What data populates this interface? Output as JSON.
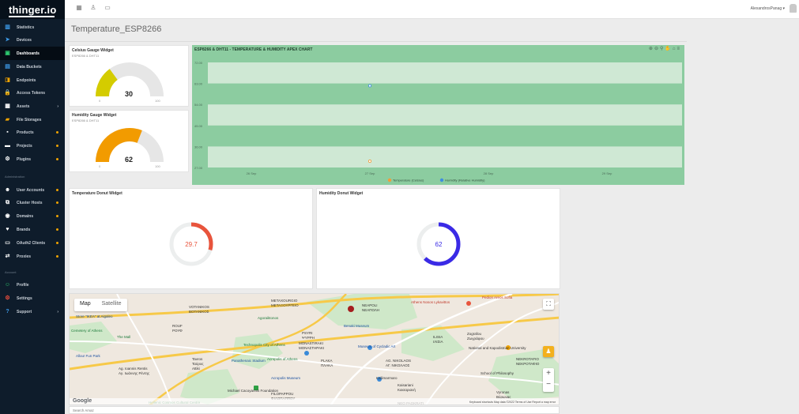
{
  "app": {
    "logo": "thinger.io"
  },
  "topbar": {
    "user_name": "AlexandrosPanag ▾"
  },
  "sidebar": {
    "items": [
      {
        "label": "Statistics",
        "icon": "chart-icon"
      },
      {
        "label": "Devices",
        "icon": "rocket-icon"
      },
      {
        "label": "Dashboards",
        "icon": "dashboard-icon"
      },
      {
        "label": "Data Buckets",
        "icon": "database-icon"
      },
      {
        "label": "Endpoints",
        "icon": "endpoint-icon"
      },
      {
        "label": "Access Tokens",
        "icon": "lock-icon"
      },
      {
        "label": "Assets",
        "icon": "assets-icon"
      },
      {
        "label": "File Storages",
        "icon": "folder-icon"
      },
      {
        "label": "Products",
        "icon": "products-icon"
      },
      {
        "label": "Projects",
        "icon": "projects-icon"
      },
      {
        "label": "Plugins",
        "icon": "plugins-icon"
      },
      {
        "label": "User Accounts",
        "icon": "users-icon"
      },
      {
        "label": "Cluster Hosts",
        "icon": "cluster-icon"
      },
      {
        "label": "Domains",
        "icon": "domains-icon"
      },
      {
        "label": "Brands",
        "icon": "brands-icon"
      },
      {
        "label": "OAuth2 Clients",
        "icon": "oauth-icon"
      },
      {
        "label": "Proxies",
        "icon": "proxies-icon"
      },
      {
        "label": "Profile",
        "icon": "profile-icon"
      },
      {
        "label": "Settings",
        "icon": "settings-icon"
      },
      {
        "label": "Support",
        "icon": "support-icon"
      }
    ],
    "section_admin": "Administration",
    "section_account": "Account"
  },
  "page": {
    "title": "Temperature_ESP8266"
  },
  "widgets": {
    "celsius_gauge": {
      "title": "Celsius Gauge Widget",
      "subtitle": "ESP8266 & DHT11",
      "value": "30",
      "min": "0",
      "max": "100",
      "fraction": 0.3,
      "color": "#d4cc00"
    },
    "humidity_gauge": {
      "title": "Humidity Gauge Widget",
      "subtitle": "ESP8266 & DHT11",
      "value": "62",
      "min": "0",
      "max": "100",
      "fraction": 0.62,
      "color": "#f29b00"
    },
    "temp_donut": {
      "title": "Temperature Donut Widget",
      "value": "29.7",
      "fraction": 0.297,
      "color": "#e8543c"
    },
    "hum_donut": {
      "title": "Humidity Donut Widget",
      "value": "62",
      "fraction": 0.62,
      "color": "#3a2ae6"
    }
  },
  "chart_data": {
    "type": "line",
    "title": "ESP8266 & DHT11 - TEMPERATURE & HUMIDITY APEX CHART",
    "y_ticks": [
      "72.00",
      "63.00",
      "54.00",
      "45.00",
      "36.00",
      "27.00"
    ],
    "x_ticks": [
      "26 Sep",
      "27 Sep",
      "28 Sep",
      "29 Sep"
    ],
    "ylim": [
      27,
      72
    ],
    "series": [
      {
        "name": "Temperature (Celsius)",
        "color": "#f29b3a",
        "points": [
          {
            "x": "27 Sep",
            "y": 29.7
          }
        ]
      },
      {
        "name": "Humidity (Relative Humidity)",
        "color": "#3d8de0",
        "points": [
          {
            "x": "27 Sep",
            "y": 62
          }
        ]
      }
    ],
    "legend": "bottom-center",
    "grid": true
  },
  "map": {
    "type_map": "Map",
    "type_satellite": "Satellite",
    "labels": [
      "METAXOURGIO",
      "ΜΕΤΑΞΟΥΡΓΕΙΟ",
      "NEAPOLI",
      "ΝΕΑΠΟΛΗ",
      "Athens Nosos Lykavittos",
      "Pedion Areos Sofia",
      "VOTANIKOS",
      "ΒΟΤΑΝΙΚΟΣ",
      "Agoraiktonos",
      "Store \"IKEA\" at Aigaleo",
      "ROUF",
      "ΡΟΥΦ",
      "Cemetery of Athens",
      "The Mall",
      "Benaki Museum",
      "PSYRI",
      "ΨΥΡΡΗ",
      "ILISIA",
      "ΙΛΙΣΙΑ",
      "Zografou",
      "Ζωγράφου",
      "Technopolis City of Athens",
      "MONASTIRAKI",
      "ΜΟΝΑΣΤΗΡΑΚΙ",
      "Museum of Cycladic Art",
      "National and Kapodistrian University",
      "Allou! Fun Park",
      "Acropolis of Athens",
      "PLAKA",
      "ΠΛΑΚΑ",
      "AG. NIKOLAOS",
      "ΑΓ. ΝΙΚΟΛΑΟΣ",
      "Tavros",
      "Ταύρος",
      "Attiki",
      "Panathenaic Stadium",
      "Ag. Ioannis Rentis",
      "Αγ. Ιωάννης Ρέντης",
      "Acropolis Museum",
      "Kallimarmaro",
      "Kaisariani",
      "Καισαριανή",
      "NEKROTAFIO",
      "ΝΕΚΡΟΤΑΦΙΟ",
      "School of Philosophy",
      "Michael Cacoyannis Foundation",
      "FILOPAPPOU",
      "ΦΙΛΟΠΑΠΠΟΥ",
      "Hellenic Cosmos Cultural Centre",
      "NEO PAGKRATI",
      "Vyronas",
      "Βύρωνας"
    ],
    "attribution": "Keyboard shortcuts   Map data ©2022   Terms of Use   Report a map error",
    "google": "Google"
  },
  "search": {
    "placeholder": "Search Amaz"
  }
}
